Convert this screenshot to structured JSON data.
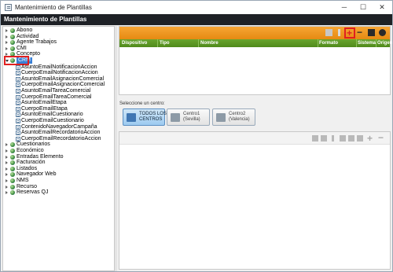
{
  "window": {
    "title": "Mantenimiento de Plantillas"
  },
  "header": {
    "title": "Mantenimiento de Plantillas"
  },
  "tree": {
    "roots_top": [
      {
        "label": "Abono"
      },
      {
        "label": "Actividad"
      },
      {
        "label": "Agente Trabajos"
      },
      {
        "label": "CMI"
      },
      {
        "label": "Concepto"
      }
    ],
    "selected": {
      "label": "CRM"
    },
    "crm_children": [
      {
        "label": "AsuntoEmailNotificacionAccion"
      },
      {
        "label": "CuerpoEmailNotificacionAccion"
      },
      {
        "label": "AsuntoEmailAsignacionComercial"
      },
      {
        "label": "CuerpoEmailAsignacionComercial"
      },
      {
        "label": "AsuntoEmailTareaComercial"
      },
      {
        "label": "CuerpoEmailTareaComercial"
      },
      {
        "label": "AsuntoEmailEtapa"
      },
      {
        "label": "CuerpoEmailEtapa"
      },
      {
        "label": "AsuntoEmailCuestionario"
      },
      {
        "label": "CuerpoEmailCuestionario"
      },
      {
        "label": "ContenidoNavegadorCampaña"
      },
      {
        "label": "AsuntoEmailRecordatorioAccion"
      },
      {
        "label": "CuerpoEmailRecordatorioAccion"
      }
    ],
    "roots_bottom": [
      {
        "label": "Cuestionarios"
      },
      {
        "label": "Económico"
      },
      {
        "label": "Entradas Elemento"
      },
      {
        "label": "Facturación"
      },
      {
        "label": "Listados"
      },
      {
        "label": "Navegador Web"
      },
      {
        "label": "NMS"
      },
      {
        "label": "Recurso"
      },
      {
        "label": "Reservas QJ"
      }
    ]
  },
  "grid": {
    "columns": [
      "Dispositivo",
      "Tipo",
      "Nombre",
      "Formato",
      "Sistema",
      "Origen"
    ]
  },
  "centers": {
    "label": "Seleccione un centro:",
    "buttons": [
      {
        "line1": "TODOS LOS",
        "line2": "CENTROS",
        "active": true
      },
      {
        "line1": "Centro1",
        "line2": "(Sevilla)",
        "active": false
      },
      {
        "line1": "Centro2",
        "line2": "(Valencia)",
        "active": false
      }
    ]
  },
  "colors": {
    "orange": "#f19a22",
    "green": "#5c9a24",
    "header": "#1e2126",
    "highlight": "#e02020",
    "selection": "#3a7fd5"
  },
  "icons": {
    "window": "app-icon",
    "minimize": "─",
    "maximize": "☐",
    "close": "✕",
    "plus": "+",
    "minus": "−"
  }
}
